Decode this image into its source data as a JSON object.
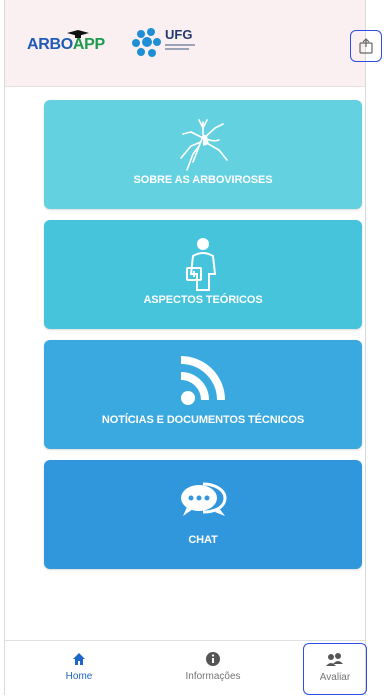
{
  "header": {
    "logo_arbo_part1": "ARBO",
    "logo_arbo_part2": "APP",
    "logo_ufg": "UFG"
  },
  "cards": [
    {
      "label": "SOBRE AS ARBOVIROSES",
      "icon": "mosquito-icon",
      "color": "#64d1e0"
    },
    {
      "label": "ASPECTOS TEÓRICOS",
      "icon": "doctor-icon",
      "color": "#45c4dc"
    },
    {
      "label": "NOTÍCIAS E DOCUMENTOS TÉCNICOS",
      "icon": "rss-icon",
      "color": "#3aa9df"
    },
    {
      "label": "CHAT",
      "icon": "chat-icon",
      "color": "#3197dd"
    }
  ],
  "nav": {
    "home_label": "Home",
    "info_label": "Informações",
    "avaliar_label": "Avaliar"
  },
  "colors": {
    "header_bg": "#faf0f1",
    "nav_active": "#1f66c9",
    "nav_inactive": "#757575"
  }
}
